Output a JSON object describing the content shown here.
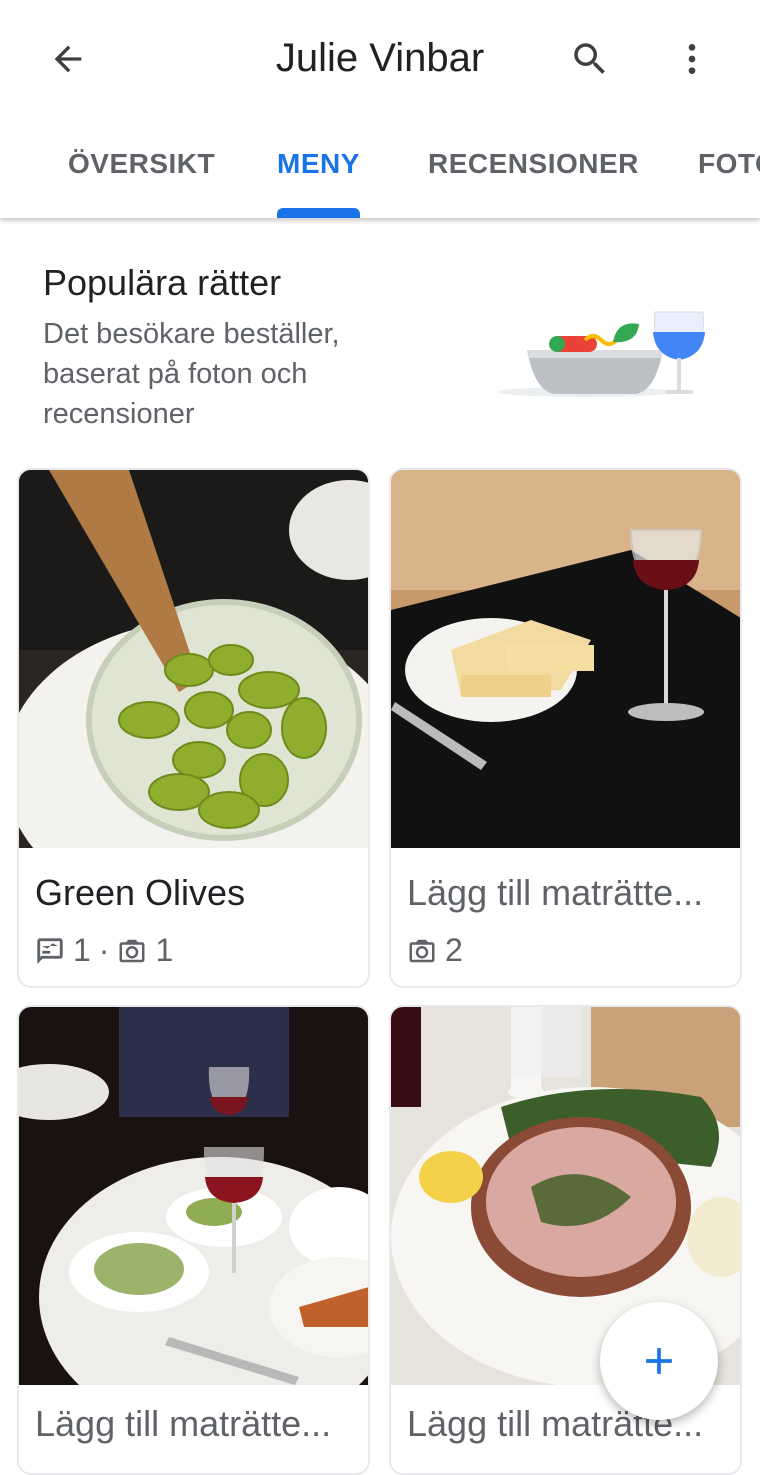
{
  "header": {
    "title": "Julie Vinbar"
  },
  "tabs": [
    {
      "label": "ÖVERSIKT",
      "active": false
    },
    {
      "label": "MENY",
      "active": true
    },
    {
      "label": "RECENSIONER",
      "active": false
    },
    {
      "label": "FOTON",
      "active": false
    }
  ],
  "popular": {
    "title": "Populära rätter",
    "subtitle": "Det besökare beställer, baserat på foton och recensioner"
  },
  "dishes": [
    {
      "name": "Green Olives",
      "reviews": "1",
      "separator": "·",
      "photos": "1"
    },
    {
      "name": "Lägg till maträtte...",
      "photos": "2"
    },
    {
      "name": "Lägg till maträtte..."
    },
    {
      "name": "Lägg till maträtte..."
    }
  ],
  "colors": {
    "accent": "#1a73e8",
    "text": "#202124",
    "muted": "#5f6368"
  }
}
